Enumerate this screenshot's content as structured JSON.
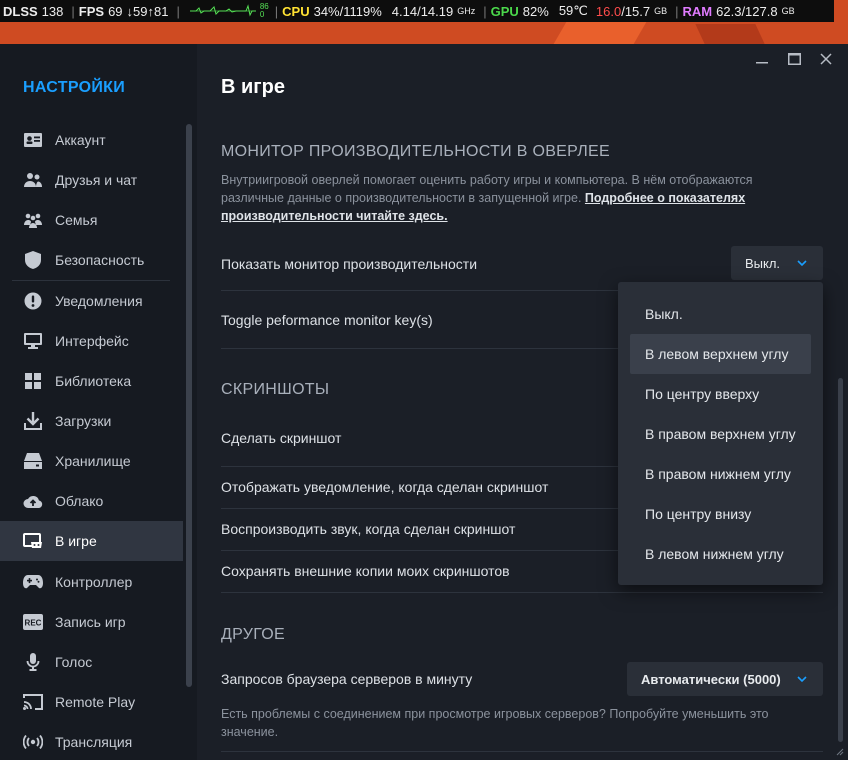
{
  "overlay": {
    "dlss_label": "DLSS",
    "dlss_value": "138",
    "fps_label": "FPS",
    "fps_value": "69",
    "fps_extra": "↓59↑81",
    "graph_top": "86",
    "graph_bottom": "0",
    "cpu_label": "CPU",
    "cpu_value": "34%/1119%",
    "cpu_freq": "4.14/14.19",
    "cpu_freq_unit": "GHz",
    "gpu_label": "GPU",
    "gpu_value": "82%",
    "gpu_temp": "59℃",
    "vram_value": "16.0",
    "vram_total": "/15.7",
    "vram_unit": "GB",
    "ram_label": "RAM",
    "ram_value": "62.3/127.8",
    "ram_unit": "GB",
    "colors": {
      "dlss": "#ffffff",
      "cpu": "#ffe233",
      "gpu": "#4bd84b",
      "vram": "#ff4c4c",
      "ram": "#e07bff"
    }
  },
  "sidebar": {
    "title": "НАСТРОЙКИ",
    "items": [
      {
        "label": "Аккаунт",
        "icon": "account-card-icon"
      },
      {
        "label": "Друзья и чат",
        "icon": "friends-icon"
      },
      {
        "label": "Семья",
        "icon": "family-icon"
      },
      {
        "label": "Безопасность",
        "icon": "shield-icon"
      },
      {
        "label": "Уведомления",
        "icon": "alert-icon"
      },
      {
        "label": "Интерфейс",
        "icon": "monitor-icon"
      },
      {
        "label": "Библиотека",
        "icon": "grid-icon"
      },
      {
        "label": "Загрузки",
        "icon": "download-icon"
      },
      {
        "label": "Хранилище",
        "icon": "storage-icon"
      },
      {
        "label": "Облако",
        "icon": "cloud-icon"
      },
      {
        "label": "В игре",
        "icon": "ingame-icon"
      },
      {
        "label": "Контроллер",
        "icon": "gamepad-icon"
      },
      {
        "label": "Запись игр",
        "icon": "rec-icon"
      },
      {
        "label": "Голос",
        "icon": "microphone-icon"
      },
      {
        "label": "Remote Play",
        "icon": "cast-icon"
      },
      {
        "label": "Трансляция",
        "icon": "broadcast-icon"
      }
    ],
    "active_index": 10
  },
  "main": {
    "title": "В игре",
    "perf_section": "МОНИТОР ПРОИЗВОДИТЕЛЬНОСТИ В ОВЕРЛЕЕ",
    "perf_desc": "Внутриигровой оверлей помогает оценить работу игры и компьютера. В нём отображаются различные данные о производительности в запущенной игре.",
    "perf_link": "Подробнее о показателях производительности читайте здесь.",
    "show_monitor_label": "Показать монитор производительности",
    "show_monitor_value": "Выкл.",
    "toggle_key_label": "Toggle peformance monitor key(s)",
    "screens_section": "СКРИНШОТЫ",
    "take_screenshot_label": "Сделать скриншот",
    "notify_label": "Отображать уведомление, когда сделан скриншот",
    "sound_label": "Воспроизводить звук, когда сделан скриншот",
    "save_copies_label": "Сохранять внешние копии моих скриншотов",
    "other_section": "ДРУГОЕ",
    "browser_requests_label": "Запросов браузера серверов в минуту",
    "browser_requests_value": "Автоматически (5000)",
    "browser_hint": "Есть проблемы с соединением при просмотре игровых серверов? Попробуйте уменьшить это значение."
  },
  "dropdown": {
    "options": [
      "Выкл.",
      "В левом верхнем углу",
      "По центру вверху",
      "В правом верхнем углу",
      "В правом нижнем углу",
      "По центру внизу",
      "В левом нижнем углу"
    ],
    "highlighted_index": 1
  },
  "colors": {
    "accent": "#1a9fff",
    "sidebar_bg": "#161a21",
    "main_bg": "#1b1f27",
    "dropdown_bg": "#2a2f38"
  }
}
